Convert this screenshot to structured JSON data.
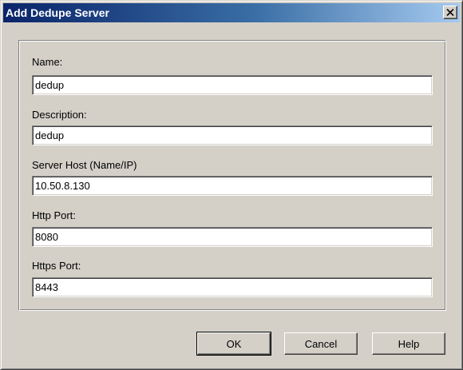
{
  "window": {
    "title": "Add Dedupe Server",
    "close_icon": "close-icon"
  },
  "form": {
    "name": {
      "label": "Name:",
      "value": "dedup"
    },
    "description": {
      "label": "Description:",
      "value": "dedup"
    },
    "server_host": {
      "label": "Server Host (Name/IP)",
      "value": "10.50.8.130"
    },
    "http_port": {
      "label": "Http Port:",
      "value": "8080"
    },
    "https_port": {
      "label": "Https Port:",
      "value": "8443"
    }
  },
  "buttons": {
    "ok_label": "OK",
    "cancel_label": "Cancel",
    "help_label": "Help"
  },
  "colors": {
    "title_bar_start": "#0a246a",
    "title_bar_end": "#a6caf0",
    "dialog_face": "#d4d0c8"
  }
}
